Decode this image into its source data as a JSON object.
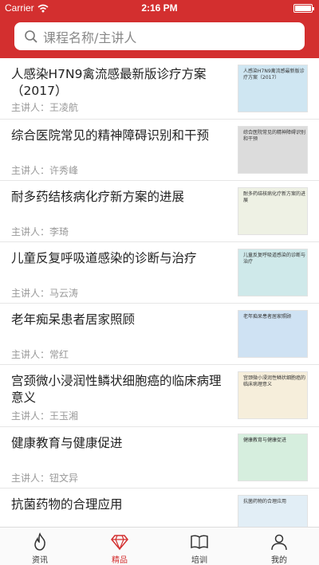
{
  "status": {
    "carrier": "Carrier",
    "time": "2:16 PM"
  },
  "search": {
    "placeholder": "课程名称/主讲人"
  },
  "courses": [
    {
      "title": "人感染H7N9禽流感最新版诊疗方案（2017）",
      "lecturer": "主讲人：王凌航",
      "thumb_text": "人感染H7N9禽流感最新版诊疗方案（2017）",
      "thumb_color": "#cfe6f2"
    },
    {
      "title": "综合医院常见的精神障碍识别和干预",
      "lecturer": "主讲人：许秀峰",
      "thumb_text": "综合医院常见的精神障碍识别和干预",
      "thumb_color": "#dcdcdc"
    },
    {
      "title": "耐多药结核病化疗新方案的进展",
      "lecturer": "主讲人：李琦",
      "thumb_text": "耐多药结核病化疗新方案的进展",
      "thumb_color": "#eef1e4"
    },
    {
      "title": "儿童反复呼吸道感染的诊断与治疗",
      "lecturer": "主讲人：马云涛",
      "thumb_text": "儿童反复呼吸道感染的诊断与治疗",
      "thumb_color": "#cfe9ea"
    },
    {
      "title": "老年痴呆患者居家照顾",
      "lecturer": "主讲人：常红",
      "thumb_text": "老年痴呆患者居家照顾",
      "thumb_color": "#cfe2f3"
    },
    {
      "title": "宫颈微小浸润性鳞状细胞癌的临床病理意义",
      "lecturer": "主讲人：王玉湘",
      "thumb_text": "宫颈微小浸润性鳞状细胞癌的临床病理意义",
      "thumb_color": "#f6eedb"
    },
    {
      "title": "健康教育与健康促进",
      "lecturer": "主讲人：钮文异",
      "thumb_text": "健康教育与健康促进",
      "thumb_color": "#d6eede"
    },
    {
      "title": "抗菌药物的合理应用",
      "lecturer": "",
      "thumb_text": "抗菌药物的合理应用",
      "thumb_color": "#e2eef6"
    }
  ],
  "tabs": [
    {
      "label": "资讯",
      "icon": "flame-icon"
    },
    {
      "label": "精品",
      "icon": "diamond-icon"
    },
    {
      "label": "培训",
      "icon": "book-icon"
    },
    {
      "label": "我的",
      "icon": "person-icon"
    }
  ],
  "colors": {
    "brand": "#d32f2f"
  }
}
